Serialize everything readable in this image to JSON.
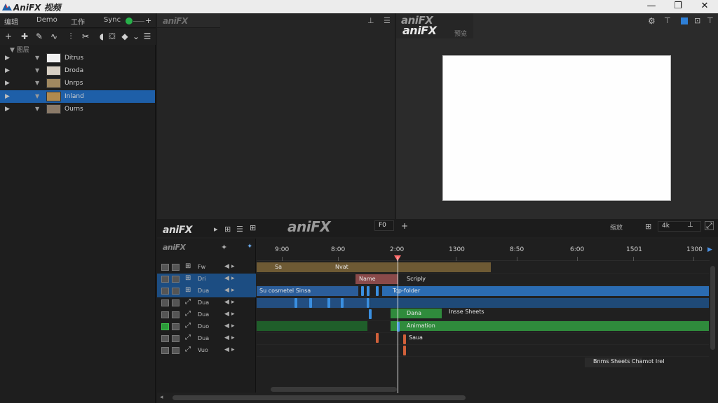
{
  "app": {
    "title": "AniFX 视频",
    "brand": "aniFX"
  },
  "window_controls": [
    "—",
    "❐",
    "✕"
  ],
  "menu": {
    "items": [
      "编辑",
      "Demo",
      "工作",
      "Sync"
    ]
  },
  "layers_panel": {
    "header": "▼ 图层",
    "rows": [
      {
        "label": "Ditrus",
        "thumb_color": "#f0f0f0",
        "selected": false
      },
      {
        "label": "Droda",
        "thumb_color": "#d8d0c4",
        "selected": false
      },
      {
        "label": "Unrps",
        "thumb_color": "#a08860",
        "selected": false
      },
      {
        "label": "Inland",
        "thumb_color": "#b08a4e",
        "selected": true
      },
      {
        "label": "Ourns",
        "thumb_color": "#8a7a68",
        "selected": false
      }
    ]
  },
  "viewer": {
    "tab_label": "aniFX",
    "right_brand": "aniFX",
    "right_tag": "预览"
  },
  "timeline": {
    "brand": "aniFX",
    "timecode": "F0",
    "zoom_label": "缩放",
    "zoom_value": "4k",
    "ruler_labels": [
      "9:00",
      "8:00",
      "2:00",
      "1300",
      "8:50",
      "6:00",
      "1501",
      "1300"
    ],
    "track_names": [
      "Fw",
      "Dri",
      "Dua",
      "Dua",
      "Dua",
      "Duo",
      "Dua",
      "Vuo"
    ],
    "clip_labels": {
      "c1": "Sa",
      "c2": "Nvat",
      "c3": "Name",
      "c4": "Scriply",
      "c5": "Su cosmetel Sinsa",
      "c6": "Tcp-folder",
      "c7": "Dana",
      "c8": "Insse Sheets",
      "c9": "Animation",
      "c10": "Saua",
      "c11": "Bnms Sheets\nChamot Irel"
    }
  },
  "colors": {
    "accent_blue": "#1e5fa8",
    "clip_gold": "#6e5a34",
    "clip_blue": "#2b5d9a",
    "clip_green": "#2f8b3c",
    "playhead": "#ff6a6a"
  }
}
